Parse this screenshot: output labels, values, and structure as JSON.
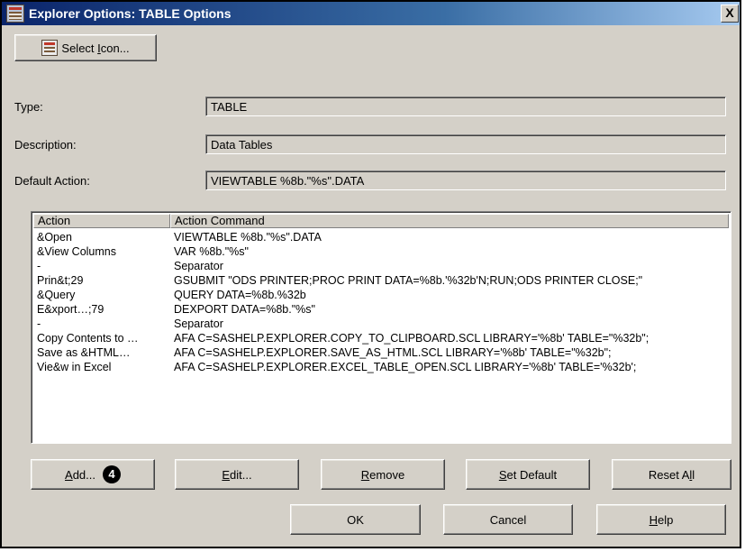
{
  "window": {
    "title": "Explorer Options: TABLE Options",
    "close_label": "X"
  },
  "select_icon": {
    "pre": "Select ",
    "mnemonic": "I",
    "post": "con..."
  },
  "fields": {
    "type_label": "Type:",
    "type_value": "TABLE",
    "description_label": "Description:",
    "description_value": "Data Tables",
    "default_action_label": "Default Action:",
    "default_action_value": "VIEWTABLE %8b.\"%s\".DATA"
  },
  "table": {
    "headers": [
      "Action",
      "Action Command"
    ],
    "rows": [
      {
        "action": "&Open",
        "command": "VIEWTABLE %8b.\"%s\".DATA"
      },
      {
        "action": "&View Columns",
        "command": "VAR %8b.\"%s\""
      },
      {
        "action": "-",
        "command": "Separator"
      },
      {
        "action": "Prin&t;29",
        "command": "GSUBMIT \"ODS PRINTER;PROC PRINT DATA=%8b.'%32b'N;RUN;ODS PRINTER CLOSE;\""
      },
      {
        "action": "&Query",
        "command": "QUERY DATA=%8b.%32b"
      },
      {
        "action": "E&xport…;79",
        "command": "DEXPORT DATA=%8b.\"%s\""
      },
      {
        "action": "-",
        "command": "Separator"
      },
      {
        "action": "Copy Contents to …",
        "command": "AFA C=SASHELP.EXPLORER.COPY_TO_CLIPBOARD.SCL LIBRARY='%8b' TABLE=\"%32b\";"
      },
      {
        "action": "Save as &HTML…",
        "command": "AFA C=SASHELP.EXPLORER.SAVE_AS_HTML.SCL LIBRARY='%8b' TABLE=\"%32b\";"
      },
      {
        "action": "Vie&w in Excel",
        "command": "AFA C=SASHELP.EXPLORER.EXCEL_TABLE_OPEN.SCL LIBRARY='%8b' TABLE='%32b';"
      }
    ]
  },
  "buttons": {
    "add": {
      "mnemonic": "A",
      "rest": "dd...",
      "step_number": "4"
    },
    "edit": {
      "mnemonic": "E",
      "rest": "dit..."
    },
    "remove": {
      "mnemonic": "R",
      "rest": "emove"
    },
    "set_default": {
      "mnemonic": "S",
      "rest": "et Default"
    },
    "reset_all": {
      "pre": "Reset A",
      "mnemonic": "l",
      "post": "l"
    },
    "ok": "OK",
    "cancel": "Cancel",
    "help": {
      "mnemonic": "H",
      "rest": "elp"
    }
  }
}
